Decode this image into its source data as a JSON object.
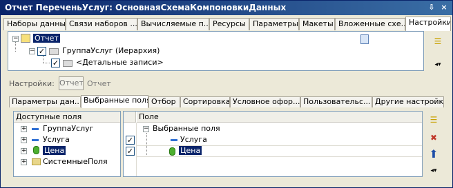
{
  "window": {
    "title": "Отчет ПереченьУслуг: ОсновнаяСхемаКомпоновкиДанных",
    "pin_glyph": "⇩",
    "close_glyph": "×"
  },
  "top_tabs": [
    {
      "label": "Наборы данных"
    },
    {
      "label": "Связи наборов ..."
    },
    {
      "label": "Вычисляемые п..."
    },
    {
      "label": "Ресурсы"
    },
    {
      "label": "Параметры"
    },
    {
      "label": "Макеты"
    },
    {
      "label": "Вложенные схе..."
    },
    {
      "label": "Настройки",
      "active": true
    }
  ],
  "structure_tree": {
    "nodes": [
      {
        "label": "Отчет",
        "selected": true
      },
      {
        "label": "ГруппаУслуг (Иерархия)"
      },
      {
        "label": "<Детальные записи>"
      }
    ]
  },
  "settings_row": {
    "label": "Настройки:",
    "selected_button": "Отчет",
    "other_text": "Отчет"
  },
  "bottom_tabs": [
    {
      "label": "Параметры дан..."
    },
    {
      "label": "Выбранные поля",
      "active": true
    },
    {
      "label": "Отбор"
    },
    {
      "label": "Сортировка"
    },
    {
      "label": "Условное офор..."
    },
    {
      "label": "Пользовательс..."
    },
    {
      "label": "Другие настройки"
    }
  ],
  "available_fields": {
    "header": "Доступные поля",
    "items": [
      {
        "label": "ГруппаУслуг",
        "icon": "field-icon"
      },
      {
        "label": "Услуга",
        "icon": "field-icon"
      },
      {
        "label": "Цена",
        "icon": "resource-icon",
        "selected": true
      },
      {
        "label": "СистемныеПоля",
        "icon": "folder-icon"
      }
    ]
  },
  "selected_fields": {
    "header": "Поле",
    "group_label": "Выбранные поля",
    "items": [
      {
        "label": "Услуга",
        "icon": "field-icon",
        "checked": true
      },
      {
        "label": "Цена",
        "icon": "resource-icon",
        "checked": true,
        "selected": true
      }
    ]
  },
  "colors": {
    "title_bar": "#0a246a",
    "selection": "#0a246a",
    "window_bg": "#ECE9D8"
  }
}
